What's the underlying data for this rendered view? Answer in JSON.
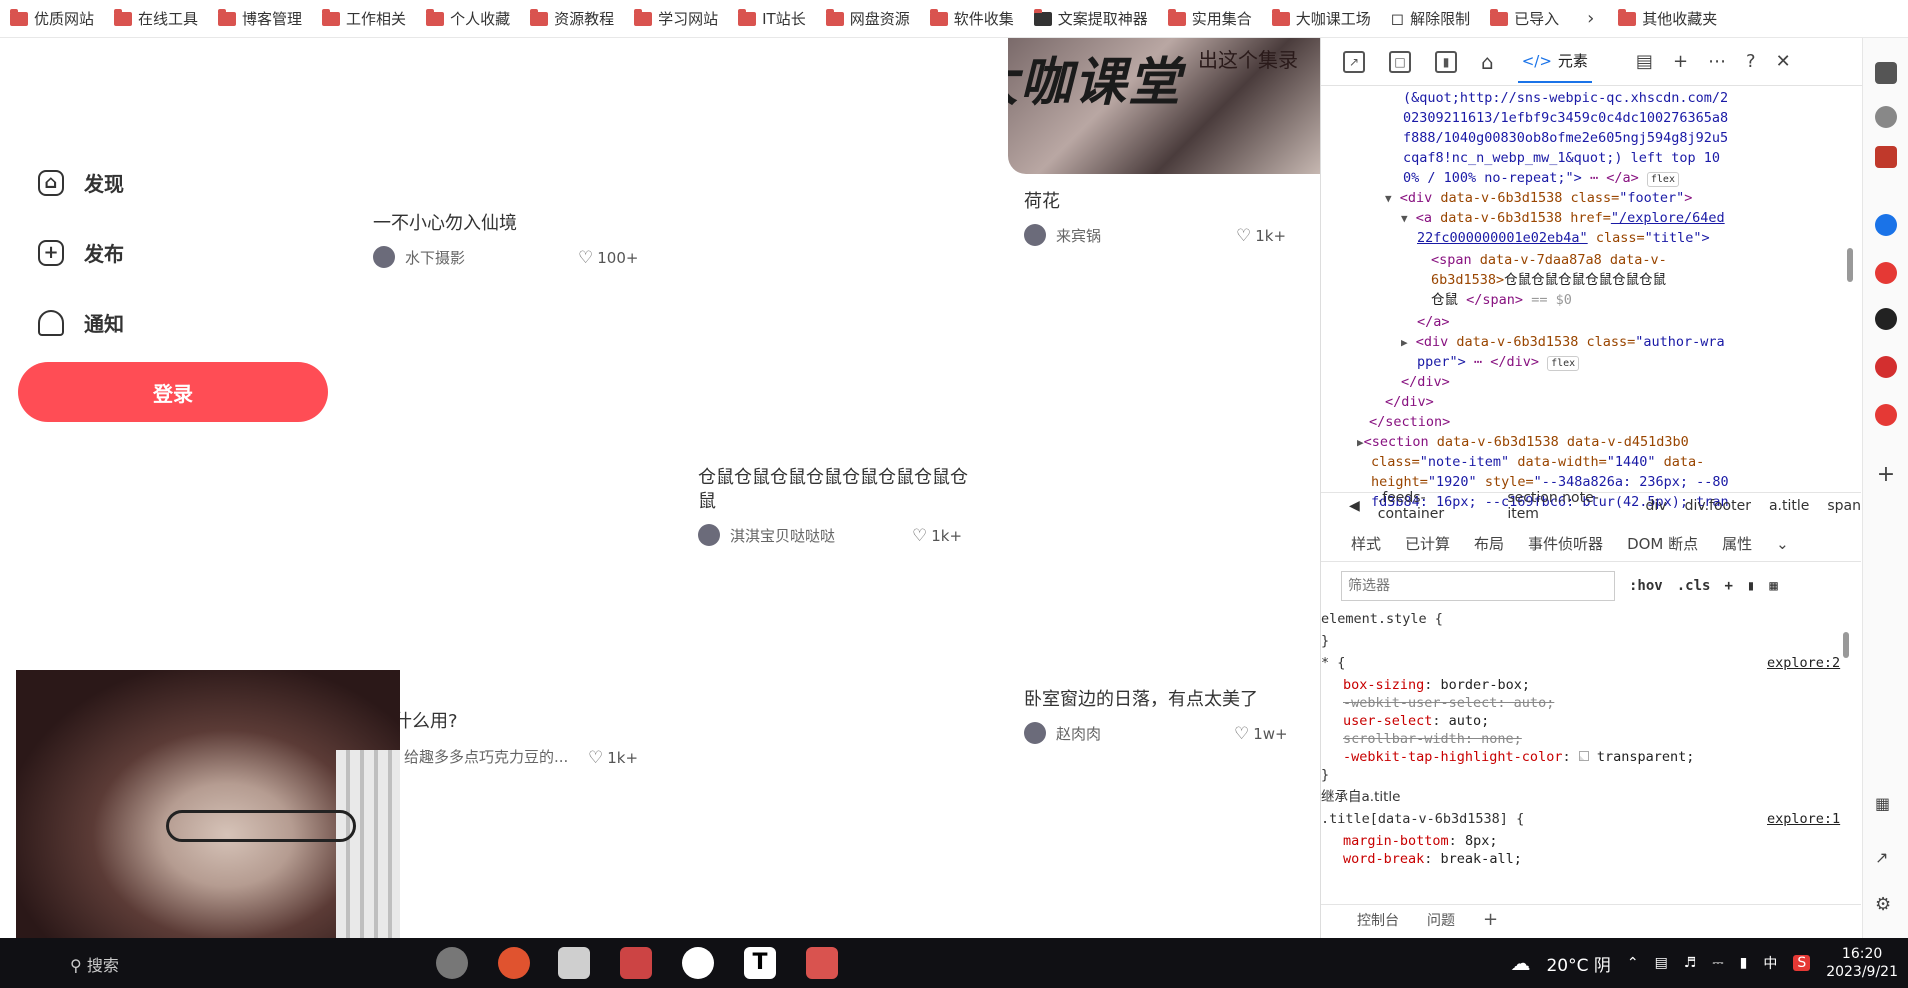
{
  "bookmarks": [
    "优质网站",
    "在线工具",
    "博客管理",
    "工作相关",
    "个人收藏",
    "资源教程",
    "学习网站",
    "IT站长",
    "网盘资源",
    "软件收集",
    "文案提取神器",
    "实用集合",
    "大咖课工场",
    "解除限制",
    "已导入",
    "其他收藏夹"
  ],
  "sidebar": {
    "discover": "发现",
    "publish": "发布",
    "notify": "通知",
    "login": "登录"
  },
  "feed": {
    "image_caption": "出这个集录",
    "cards": [
      {
        "title": "一不小心勿入仙境",
        "author": "水下摄影",
        "likes": "100+"
      },
      {
        "title": "荷花",
        "author": "来宾锅",
        "likes": "1k+"
      },
      {
        "title": "仓鼠仓鼠仓鼠仓鼠仓鼠仓鼠仓鼠仓鼠",
        "author": "淇淇宝贝哒哒哒",
        "likes": "1k+"
      },
      {
        "title": "卧室窗边的日落，有点太美了",
        "author": "赵肉肉",
        "likes": "1w+"
      },
      {
        "title": "什么用?",
        "author": "给趣多多点巧克力豆的...",
        "likes": "1k+"
      }
    ]
  },
  "devtools": {
    "tab_label": "元素",
    "dom_lines": {
      "l1": "(&quot;http://sns-webpic-qc.xhscdn.com/2",
      "l2": "02309211613/1efbf9c3459c0c4dc100276365a8",
      "l3": "f888/1040g00830ob8ofme2e605ngj594g8j92u5",
      "l4": "cqaf8!nc_n_webp_mw_1&quot;) left top 10",
      "l5": "0% / 100% no-repeat;\">",
      "l5b": "</a>",
      "flex": "flex",
      "footer_tag": "<div",
      "footer_attr": "data-v-6b3d1538",
      "footer_class": "class=",
      "footer_val": "\"footer\"",
      "a_tag": "<a",
      "a_attr": "data-v-6b3d1538 href=",
      "a_val": "\"/explore/64ed",
      "a_val2": "22fc000000001e02eb4a\"",
      "a_class": "class=",
      "a_classval": "\"title\">",
      "span_tag": "<span",
      "span_attr": "data-v-7daa87a8 data-v-",
      "span_attr2": "6b3d1538>",
      "span_text": "仓鼠仓鼠仓鼠仓鼠仓鼠仓鼠",
      "span_text2": "仓鼠",
      "span_close": "</span>",
      "span_eq": "== $0",
      "a_close": "</a>",
      "author_tag": "<div",
      "author_attr": "data-v-6b3d1538 class=",
      "author_val": "\"author-wra",
      "author_val2": "pper\">",
      "author_close": "</div>",
      "div_close1": "</div>",
      "div_close2": "</div>",
      "section_close": "</section>",
      "section_tag": "<section",
      "section_attr": "data-v-6b3d1538 data-v-d451d3b0",
      "section_l2a": "class=",
      "section_l2b": "\"note-item\"",
      "section_l2c": " data-width=",
      "section_l2d": "\"1440\"",
      "section_l2e": " data-",
      "section_l3a": "height=",
      "section_l3b": "\"1920\"",
      "section_l3c": " style=",
      "section_l3d": "\"--348a826a: 236px; --80",
      "section_l4": "fd3b84: 16px; --c169fbc6: blur(42.5px); tran"
    },
    "breadcrumbs": [
      ".feeds-container",
      "section.note-item",
      "div",
      "div.footer",
      "a.title",
      "span"
    ],
    "subtabs": [
      "样式",
      "已计算",
      "布局",
      "事件侦听器",
      "DOM 断点",
      "属性"
    ],
    "filter_placeholder": "筛选器",
    "filter_hov": ":hov",
    "filter_cls": ".cls",
    "styles": {
      "element_style": "element.style {",
      "close": "}",
      "star_sel": "* {",
      "explore2": "explore:2",
      "box_sizing": "box-sizing",
      "box_sizing_v": "border-box;",
      "webkit_user_select": "-webkit-user-select: auto;",
      "user_select": "user-select",
      "user_select_v": "auto;",
      "scrollbar_width": "scrollbar-width: none;",
      "tap_highlight": "-webkit-tap-highlight-color",
      "tap_highlight_v": "transparent;",
      "inherited": "继承自",
      "inherited_el": "a.title",
      "title_sel": ".title[data-v-6b3d1538] {",
      "explore1": "explore:1",
      "margin_bottom": "margin-bottom",
      "margin_bottom_v": "8px;",
      "word_break": "word-break",
      "word_break_v": "break-all;"
    },
    "bottom_tabs": [
      "控制台",
      "问题"
    ]
  },
  "taskbar": {
    "search": "搜索",
    "weather": "20°C 阴",
    "ime": "中",
    "time": "16:20",
    "date": "2023/9/21"
  },
  "colors": {
    "brand_red": "#ff4d55",
    "folder_red": "#d9534f",
    "devtools_blue": "#1a73e8",
    "taskbar_bg": "#101014"
  }
}
